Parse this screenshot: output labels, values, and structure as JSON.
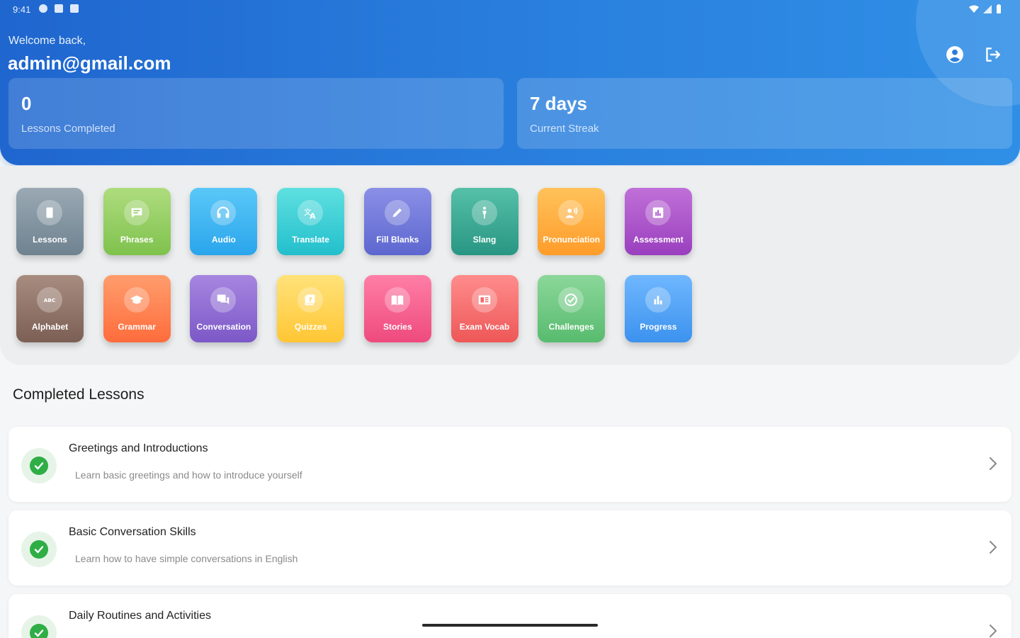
{
  "status_bar": {
    "time": "9:41"
  },
  "header": {
    "welcome": "Welcome back,",
    "email": "admin@gmail.com",
    "stats": [
      {
        "value": "0",
        "label": "Lessons Completed"
      },
      {
        "value": "7 days",
        "label": "Current Streak"
      }
    ]
  },
  "features": [
    {
      "label": "Lessons",
      "icon": "book-icon",
      "color_from": "#9aa9b4",
      "color_to": "#6f8290"
    },
    {
      "label": "Phrases",
      "icon": "chat-icon",
      "color_from": "#aedc7e",
      "color_to": "#7fc24d"
    },
    {
      "label": "Audio",
      "icon": "headphones-icon",
      "color_from": "#5ac8f8",
      "color_to": "#2aa5ec"
    },
    {
      "label": "Translate",
      "icon": "translate-icon",
      "color_from": "#5fe0e0",
      "color_to": "#22bfcc"
    },
    {
      "label": "Fill Blanks",
      "icon": "pencil-icon",
      "color_from": "#8a8fe6",
      "color_to": "#5d67cf"
    },
    {
      "label": "Slang",
      "icon": "person-icon",
      "color_from": "#56c0a8",
      "color_to": "#289683"
    },
    {
      "label": "Pronunciation",
      "icon": "speaker-person-icon",
      "color_from": "#ffc25a",
      "color_to": "#ff9c2a"
    },
    {
      "label": "Assessment",
      "icon": "assessment-icon",
      "color_from": "#c070d8",
      "color_to": "#9a3fbe"
    },
    {
      "label": "Alphabet",
      "icon": "abc-icon",
      "color_from": "#a88c80",
      "color_to": "#7c5f54"
    },
    {
      "label": "Grammar",
      "icon": "graduation-cap-icon",
      "color_from": "#ff9d6d",
      "color_to": "#ff6c3c"
    },
    {
      "label": "Conversation",
      "icon": "forum-icon",
      "color_from": "#a686e0",
      "color_to": "#7c58c7"
    },
    {
      "label": "Quizzes",
      "icon": "quiz-icon",
      "color_from": "#ffe27a",
      "color_to": "#ffc634"
    },
    {
      "label": "Stories",
      "icon": "open-book-icon",
      "color_from": "#ff7fa6",
      "color_to": "#ee4a7d"
    },
    {
      "label": "Exam Vocab",
      "icon": "newspaper-icon",
      "color_from": "#ff8c8c",
      "color_to": "#ee5757"
    },
    {
      "label": "Challenges",
      "icon": "check-circle-icon",
      "color_from": "#8bd79a",
      "color_to": "#58bb6e"
    },
    {
      "label": "Progress",
      "icon": "bar-chart-icon",
      "color_from": "#6fb7ff",
      "color_to": "#3c92ee"
    }
  ],
  "completed": {
    "title": "Completed Lessons",
    "lessons": [
      {
        "title": "Greetings and Introductions",
        "desc": "Learn basic greetings and how to introduce yourself"
      },
      {
        "title": "Basic Conversation Skills",
        "desc": "Learn how to have simple conversations in English"
      },
      {
        "title": "Daily Routines and Activities",
        "desc": ""
      }
    ]
  }
}
